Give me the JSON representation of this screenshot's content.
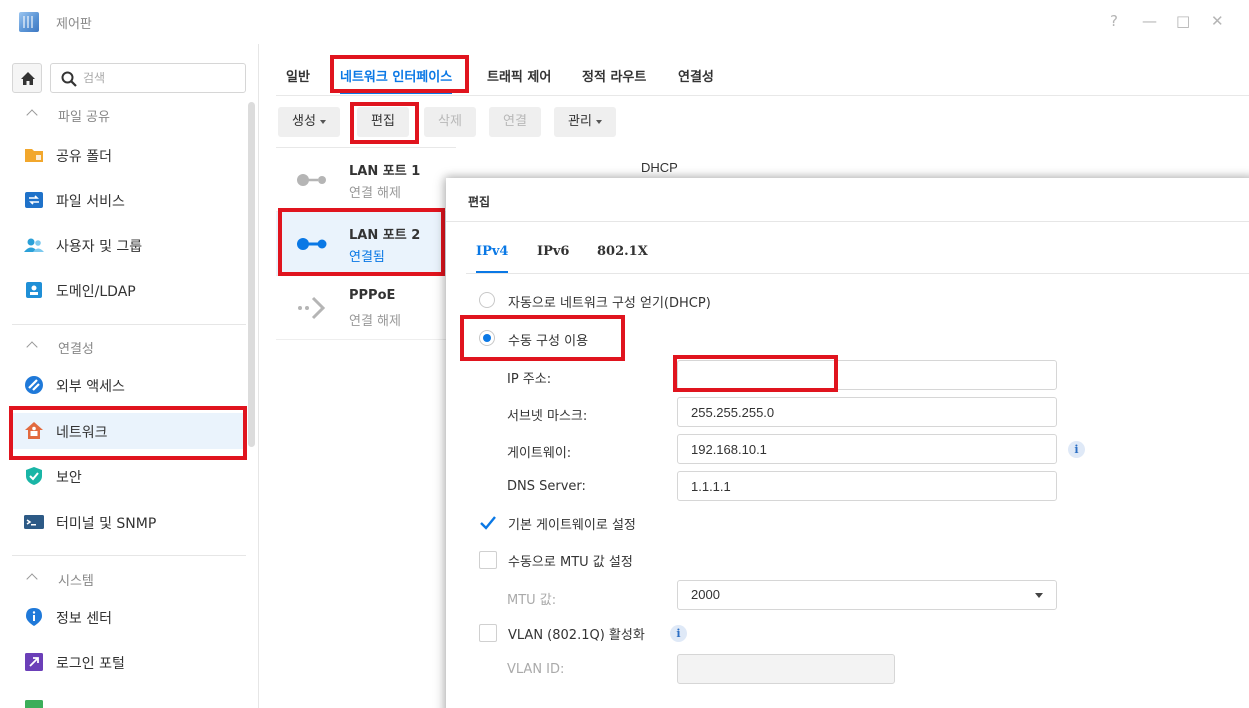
{
  "window": {
    "title": "제어판",
    "controls": {
      "help": "?",
      "minimize": "—",
      "maximize": "□",
      "close": "✕"
    }
  },
  "sidebar": {
    "search_placeholder": "검색",
    "sections": [
      {
        "header": "파일 공유",
        "items": [
          {
            "label": "공유 폴더",
            "icon": "shared-folder-icon",
            "color": "#f2a72c"
          },
          {
            "label": "파일 서비스",
            "icon": "file-services-icon",
            "color": "#1f72c9"
          },
          {
            "label": "사용자 및 그룹",
            "icon": "user-group-icon",
            "color": "#2aa0d8"
          },
          {
            "label": "도메인/LDAP",
            "icon": "domain-ldap-icon",
            "color": "#1f8fd6"
          }
        ]
      },
      {
        "header": "연결성",
        "items": [
          {
            "label": "외부 액세스",
            "icon": "external-access-icon",
            "color": "#1f79d9"
          },
          {
            "label": "네트워크",
            "icon": "network-icon",
            "color": "#e26a3f",
            "active": true
          },
          {
            "label": "보안",
            "icon": "security-shield-icon",
            "color": "#19b5a6"
          },
          {
            "label": "터미널 및 SNMP",
            "icon": "terminal-icon",
            "color": "#2d5a86"
          }
        ]
      },
      {
        "header": "시스템",
        "items": [
          {
            "label": "정보 센터",
            "icon": "info-center-icon",
            "color": "#1f79d9"
          },
          {
            "label": "로그인 포털",
            "icon": "login-portal-icon",
            "color": "#6b3fb8"
          }
        ]
      }
    ]
  },
  "main": {
    "tabs": [
      "일반",
      "네트워크 인터페이스",
      "트래픽 제어",
      "정적 라우트",
      "연결성"
    ],
    "active_tab": 1,
    "toolbar": {
      "create": "생성",
      "edit": "편집",
      "delete": "삭제",
      "connect": "연결",
      "manage": "관리"
    },
    "interfaces": [
      {
        "name": "LAN 포트 1",
        "status": "연결 해제"
      },
      {
        "name": "LAN 포트 2",
        "status": "연결됨",
        "selected": true
      },
      {
        "name": "PPPoE",
        "status": "연결 해제"
      }
    ],
    "lan1_mode": "DHCP"
  },
  "dialog": {
    "title": "편집",
    "tabs": [
      "IPv4",
      "IPv6",
      "802.1X"
    ],
    "active_tab": 0,
    "auto_option": "자동으로 네트워크 구성 얻기(DHCP)",
    "manual_option": "수동 구성 이용",
    "manual_selected": true,
    "fields": {
      "ip_label": "IP 주소:",
      "ip_value": "",
      "subnet_label": "서브넷 마스크:",
      "subnet_value": "255.255.255.0",
      "gateway_label": "게이트웨이:",
      "gateway_value": "192.168.10.1",
      "dns_label": "DNS Server:",
      "dns_value": "1.1.1.1"
    },
    "default_gateway": "기본 게이트웨이로 설정",
    "default_gateway_checked": true,
    "manual_mtu": "수동으로 MTU 값 설정",
    "manual_mtu_checked": false,
    "mtu_label": "MTU 값:",
    "mtu_value": "2000",
    "vlan": "VLAN (802.1Q) 활성화",
    "vlan_checked": false,
    "vlan_id_label": "VLAN ID:",
    "vlan_id_value": ""
  },
  "colors": {
    "accent": "#0a78e5",
    "highlight_box": "#e0141e"
  }
}
